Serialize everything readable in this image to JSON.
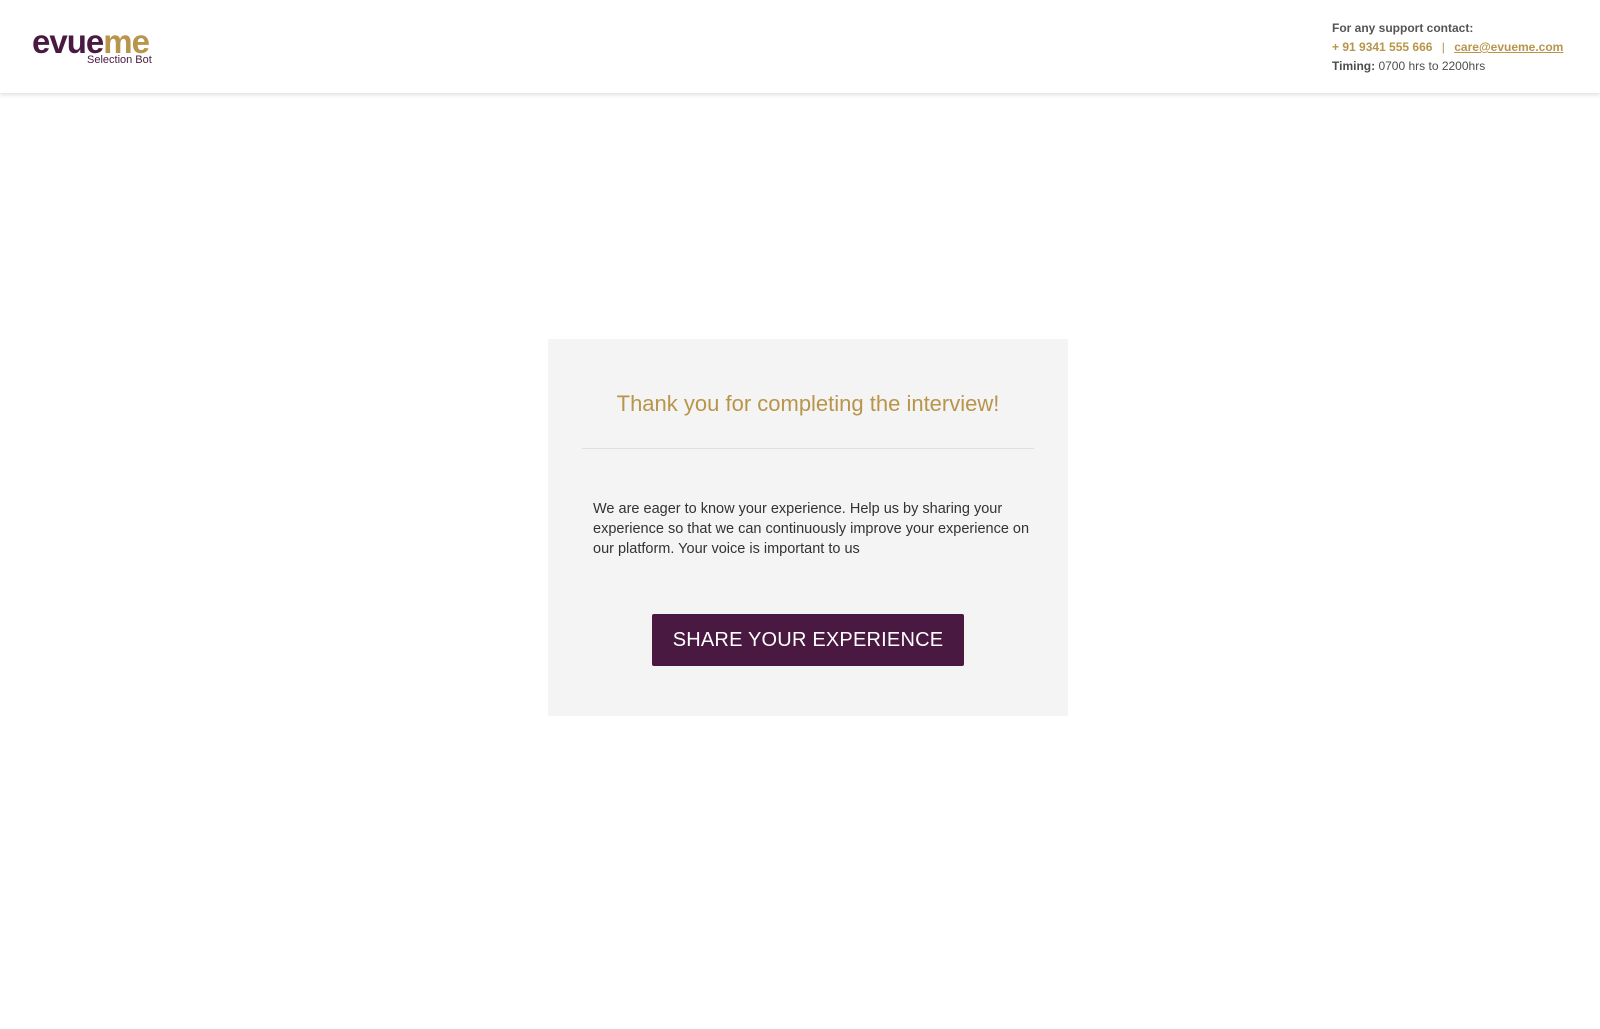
{
  "header": {
    "logo": {
      "word_part1": "ev",
      "word_part2": "ue",
      "word_part3": "me",
      "subtitle": "Selection Bot"
    },
    "support": {
      "heading": "For any support contact:",
      "phone": "+ 91 9341 555 666",
      "separator": "|",
      "email": "care@evueme.com",
      "timing_label": "Timing:",
      "timing_value": "0700 hrs to  2200hrs"
    }
  },
  "card": {
    "title": "Thank you for completing the interview!",
    "message": "We are eager to know your experience. Help us by sharing your experience so that we can continuously improve your experience on our platform. Your voice is important to us",
    "button_label": "SHARE YOUR EXPERIENCE"
  },
  "colors": {
    "brand_purple": "#4a1942",
    "brand_gold": "#b8954b",
    "card_background": "#f4f4f4"
  }
}
